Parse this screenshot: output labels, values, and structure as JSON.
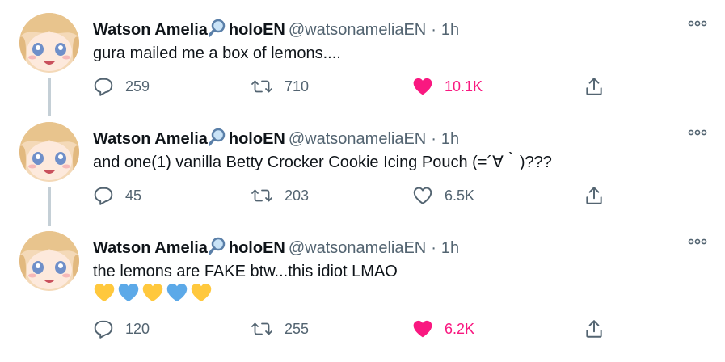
{
  "colors": {
    "accent_like": "#f91880",
    "muted": "#536471",
    "text": "#0f1419",
    "line": "#c4cfd6"
  },
  "tweets": [
    {
      "author_name": "Watson Amelia",
      "author_suffix": "holoEN",
      "handle": "@watsonameliaEN",
      "dot": "·",
      "time": "1h",
      "text": "gura mailed me a box of lemons....",
      "replies": "259",
      "retweets": "710",
      "likes": "10.1K",
      "liked": true
    },
    {
      "author_name": "Watson Amelia",
      "author_suffix": "holoEN",
      "handle": "@watsonameliaEN",
      "dot": "·",
      "time": "1h",
      "text": "and one(1) vanilla Betty Crocker Cookie Icing Pouch (=´∀｀)???",
      "replies": "45",
      "retweets": "203",
      "likes": "6.5K",
      "liked": false
    },
    {
      "author_name": "Watson Amelia",
      "author_suffix": "holoEN",
      "handle": "@watsonameliaEN",
      "dot": "·",
      "time": "1h",
      "text": "the lemons are FAKE btw...this idiot LMAO",
      "emojis": [
        "yellow-heart",
        "blue-heart",
        "yellow-heart",
        "blue-heart",
        "yellow-heart"
      ],
      "replies": "120",
      "retweets": "255",
      "likes": "6.2K",
      "liked": true
    }
  ]
}
